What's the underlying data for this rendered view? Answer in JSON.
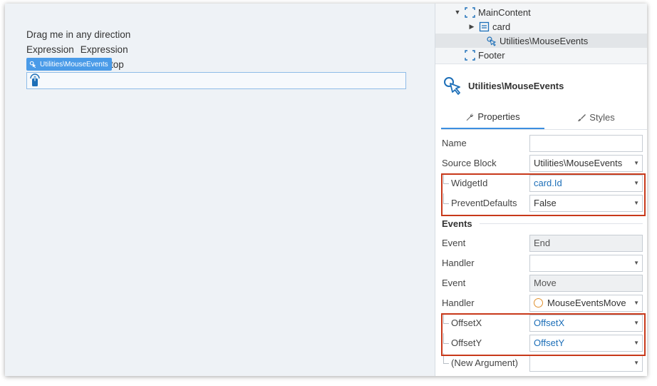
{
  "canvas": {
    "line1": "Drag me in any direction",
    "line2a": "Expression",
    "line2b": "Expression",
    "line3_tail": "top",
    "widget_tag": "Utilities\\MouseEvents"
  },
  "tree": {
    "items": [
      {
        "label": "MainContent",
        "icon": "container-icon",
        "expanded": true
      },
      {
        "label": "card",
        "icon": "card-icon",
        "expanded": false
      },
      {
        "label": "Utilities\\MouseEvents",
        "icon": "mouse-events-icon",
        "selected": true
      },
      {
        "label": "Footer",
        "icon": "container-icon"
      }
    ]
  },
  "header": {
    "title": "Utilities\\MouseEvents"
  },
  "tabs": {
    "properties": "Properties",
    "styles": "Styles"
  },
  "props": {
    "name": {
      "label": "Name",
      "value": ""
    },
    "source_block": {
      "label": "Source Block",
      "value": "Utilities\\MouseEvents"
    },
    "widget_id": {
      "label": "WidgetId",
      "value": "card.Id"
    },
    "prevent_defaults": {
      "label": "PreventDefaults",
      "value": "False"
    }
  },
  "events": {
    "section_title": "Events",
    "event1": {
      "label": "Event",
      "value": "End"
    },
    "handler1": {
      "label": "Handler",
      "value": ""
    },
    "event2": {
      "label": "Event",
      "value": "Move"
    },
    "handler2": {
      "label": "Handler",
      "value": "MouseEventsMove"
    },
    "offset_x": {
      "label": "OffsetX",
      "value": "OffsetX"
    },
    "offset_y": {
      "label": "OffsetY",
      "value": "OffsetY"
    },
    "new_argument": {
      "label": "(New Argument)",
      "value": ""
    }
  },
  "colors": {
    "accent": "#3c8ee0",
    "highlight": "#c8391a",
    "expression_text": "#1d6fb8",
    "handler_circle": "#e0912f"
  }
}
